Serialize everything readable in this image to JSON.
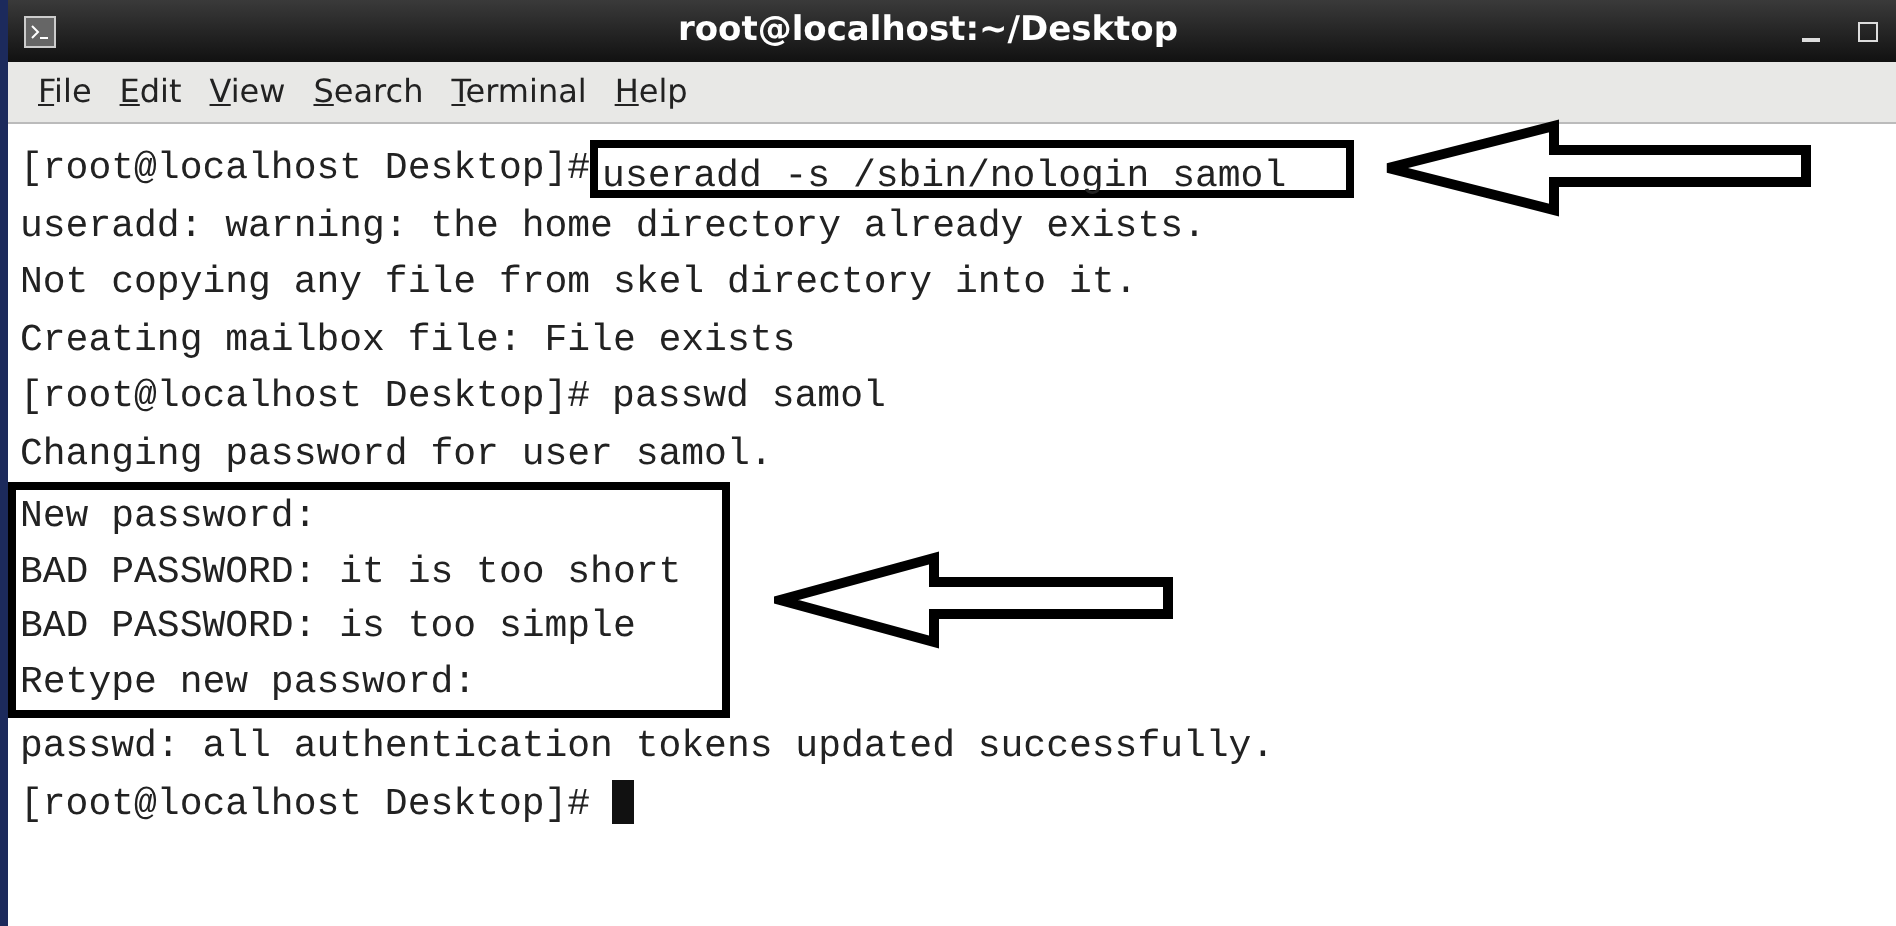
{
  "window": {
    "title": "root@localhost:~/Desktop"
  },
  "menu": [
    "File",
    "Edit",
    "View",
    "Search",
    "Terminal",
    "Help"
  ],
  "lines": [
    {
      "kind": "prompt",
      "prompt": "[root@localhost Desktop]#",
      "command": "useradd -s /sbin/nologin samol",
      "boxed": true
    },
    {
      "kind": "output",
      "text": "useradd: warning: the home directory already exists.",
      "boxed": false
    },
    {
      "kind": "output",
      "text": "Not copying any file from skel directory into it.",
      "boxed": false
    },
    {
      "kind": "output",
      "text": "Creating mailbox file: File exists",
      "boxed": false
    },
    {
      "kind": "prompt",
      "prompt": "[root@localhost Desktop]#",
      "command": "passwd samol",
      "boxed": false
    },
    {
      "kind": "output",
      "text": "Changing password for user samol.",
      "boxed": false
    },
    {
      "kind": "output",
      "text": "New password:",
      "boxed": true
    },
    {
      "kind": "output",
      "text": "BAD PASSWORD: it is too short",
      "boxed": true
    },
    {
      "kind": "output",
      "text": "BAD PASSWORD: is too simple",
      "boxed": true
    },
    {
      "kind": "output",
      "text": "Retype new password:",
      "boxed": true
    },
    {
      "kind": "output",
      "text": "passwd: all authentication tokens updated successfully.",
      "boxed": false
    },
    {
      "kind": "prompt",
      "prompt": "[root@localhost Desktop]#",
      "cursor": true,
      "boxed": false
    }
  ]
}
